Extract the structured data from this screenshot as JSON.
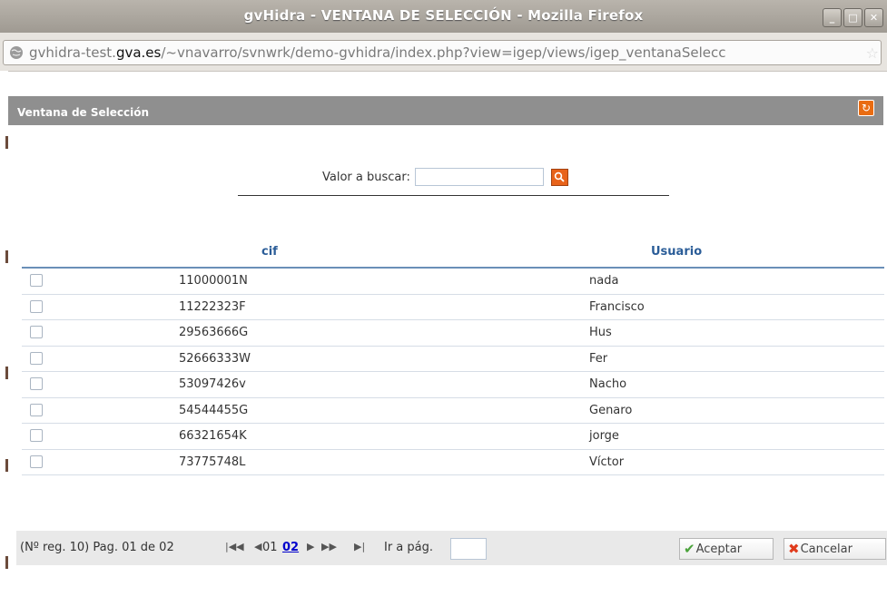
{
  "window": {
    "title": "gvHidra - VENTANA DE SELECCIÓN - Mozilla Firefox",
    "url_prefix": "gvhidra-test.",
    "url_domain": "gva.es",
    "url_suffix": "/~vnavarro/svnwrk/demo-gvhidra/index.php?view=igep/views/igep_ventanaSelecc"
  },
  "panel": {
    "title": "Ventana de Selección"
  },
  "search": {
    "label": "Valor a buscar:",
    "value": ""
  },
  "table": {
    "columns": [
      "cif",
      "Usuario"
    ],
    "rows": [
      {
        "cif": "11000001N",
        "usuario": "nada"
      },
      {
        "cif": "11222323F",
        "usuario": "Francisco"
      },
      {
        "cif": "29563666G",
        "usuario": "Hus"
      },
      {
        "cif": "52666333W",
        "usuario": "Fer"
      },
      {
        "cif": "53097426v",
        "usuario": "Nacho"
      },
      {
        "cif": "54544455G",
        "usuario": "Genaro"
      },
      {
        "cif": "66321654K",
        "usuario": "jorge"
      },
      {
        "cif": "73775748L",
        "usuario": "Víctor"
      }
    ]
  },
  "pagination": {
    "summary": "(Nº reg. 10) Pag. 01 de 02",
    "page_current": "01",
    "page_link": "02",
    "goto_label": "Ir a pág.",
    "goto_value": ""
  },
  "buttons": {
    "accept": "Aceptar",
    "cancel": "Cancelar"
  },
  "colors": {
    "accent": "#2b5d98",
    "header_bg": "#8f8f8f",
    "search_button": "#e8631a"
  }
}
